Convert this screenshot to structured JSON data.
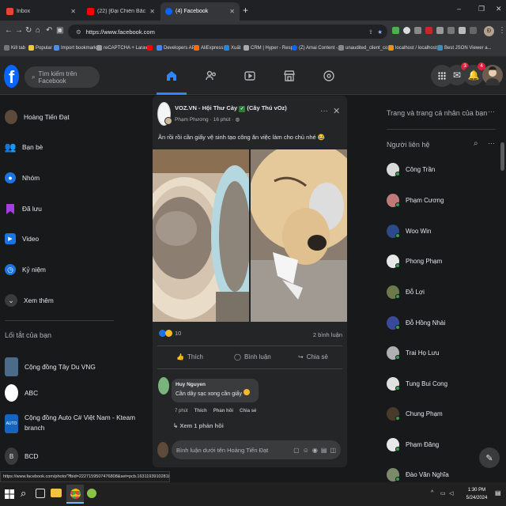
{
  "browser": {
    "tabs": [
      {
        "title": "Inbox",
        "favicon_color": "#ea4335",
        "active": false
      },
      {
        "title": "(22) [Đại Chiến Bắc Nam] Bắ",
        "favicon_color": "#ff0000",
        "active": false
      },
      {
        "title": "(4) Facebook",
        "favicon_color": "#0866ff",
        "active": true
      }
    ],
    "new_tab": "+",
    "window_controls": {
      "minimize": "–",
      "maximize": "❐",
      "close": "✕"
    },
    "url": "https://www.facebook.com",
    "profile_initial": "Đ",
    "bookmarks": [
      "Kill tab",
      "Popular",
      "Import bookmarks",
      "reCAPTCHA + Laravi...",
      "",
      "Developers API",
      "AliExpress",
      "Xuất",
      "CRM | Hyper - Resp...",
      "(Z) Amai Content -...",
      "unaudited_client_co...",
      "localhost / localhost...",
      "Best JSON Viewer a..."
    ]
  },
  "fb": {
    "search_placeholder": "Tìm kiếm trên Facebook",
    "badges": {
      "messenger": "3",
      "notifications": "4"
    },
    "left_menu": [
      {
        "label": "Hoàng Tiến Đạt",
        "icon": "avatar"
      },
      {
        "label": "Bạn bè",
        "icon": "friends-icon"
      },
      {
        "label": "Nhóm",
        "icon": "groups-icon"
      },
      {
        "label": "Đã lưu",
        "icon": "bookmark-icon"
      },
      {
        "label": "Video",
        "icon": "video-icon"
      },
      {
        "label": "Kỷ niệm",
        "icon": "clock-icon"
      },
      {
        "label": "Xem thêm",
        "icon": "chevron-down-icon"
      }
    ],
    "shortcuts_title": "Lối tắt của bạn",
    "shortcuts": [
      {
        "label": "Cộng đồng Tây Du VNG"
      },
      {
        "label": "ABC"
      },
      {
        "label": "Cộng đồng Auto C# Việt Nam - Kteam branch",
        "line1": "Cộng đồng Auto C# Việt Nam - Kteam",
        "line2": "branch"
      },
      {
        "label": "BCD"
      }
    ],
    "post": {
      "group": "VOZ.VN - Hội Thư Cày",
      "group_suffix": "(Cây Thú vOz)",
      "author": "Phạm Phương",
      "time": "16 phút",
      "text": "Ăn rồi rồi cần giấy vệ sinh tạo công ăn việc làm cho chủ nhé 😂",
      "reaction_count": "10",
      "comment_count": "2 bình luận",
      "actions": {
        "like": "Thích",
        "comment": "Bình luận",
        "share": "Chia sẻ"
      },
      "comment": {
        "author": "Huy Nguyen",
        "text": "Cần dây sạc xong cần giấy",
        "time": "7 phút",
        "like": "Thích",
        "reply": "Phản hồi",
        "share": "Chia sẻ"
      },
      "view_replies": "Xem 1 phản hồi",
      "comment_placeholder": "Bình luận dưới tên Hoàng Tiến Đạt"
    },
    "right": {
      "pages_title": "Trang và trang cá nhân của bạn",
      "contacts_title": "Người liên hệ",
      "contacts": [
        "Công Trần",
        "Phạm Cương",
        "Woo Win",
        "Phong Phạm",
        "Đỗ Lợi",
        "Đỗ Hồng Nhài",
        "Trai Họ Lưu",
        "Tung Bui Cong",
        "Chung Phạm",
        "Phạm Đăng",
        "Đào Văn Nghĩa"
      ]
    }
  },
  "status_url": "https://www.facebook.com/photo/?fbid=2227159507476808&set=pcb.1631193910281888...",
  "taskbar": {
    "time": "1:30 PM",
    "date": "5/24/2024"
  }
}
